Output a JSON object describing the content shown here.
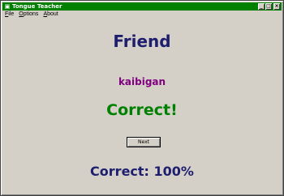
{
  "window": {
    "title": "Tongue Teacher",
    "title_bar_color": "#008000",
    "icon": "app-icon",
    "controls": {
      "minimize": "_",
      "maximize": "□",
      "close": "×"
    }
  },
  "menu": {
    "items": [
      {
        "mnemonic": "F",
        "rest": "ile"
      },
      {
        "mnemonic": "O",
        "rest": "ptions"
      },
      {
        "mnemonic": "A",
        "rest": "bout"
      }
    ]
  },
  "quiz": {
    "word": "Friend",
    "translation": "kaibigan",
    "result": "Correct!",
    "next_label": "Next",
    "score_text": "Correct: 100%"
  },
  "colors": {
    "word": "#1e1e6e",
    "translation": "#800080",
    "result": "#008000",
    "score": "#1e1e6e"
  }
}
